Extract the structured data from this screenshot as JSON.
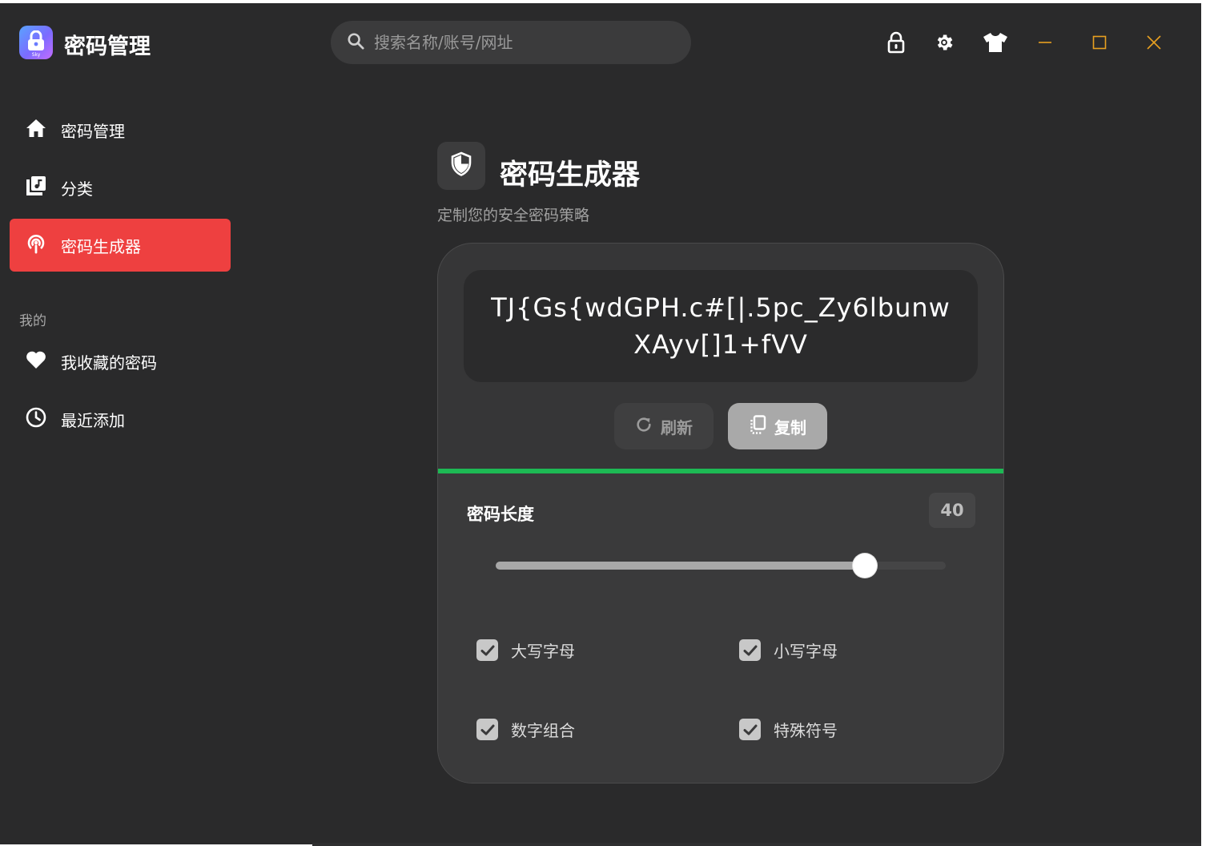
{
  "app": {
    "title": "密码管理",
    "logo_text": "Sky"
  },
  "search": {
    "placeholder": "搜索名称/账号/网址"
  },
  "toolbar": {
    "icons": [
      "lock-icon",
      "gear-icon",
      "tshirt-icon"
    ]
  },
  "window_controls": {
    "accent_color": "#e8a020"
  },
  "sidebar": {
    "items": [
      {
        "label": "密码管理",
        "icon": "home-icon"
      },
      {
        "label": "分类",
        "icon": "music-library-icon"
      },
      {
        "label": "密码生成器",
        "icon": "podcast-icon",
        "active": true
      }
    ],
    "section_title": "我的",
    "my_items": [
      {
        "label": "我收藏的密码",
        "icon": "heart-icon"
      },
      {
        "label": "最近添加",
        "icon": "clock-icon"
      }
    ],
    "active_color": "#ee4040"
  },
  "generator": {
    "title": "密码生成器",
    "subtitle": "定制您的安全密码策略",
    "password": "TJ{Gs{wdGPH.c#[|.5pc_Zy6lbunwXAyv[]1+fVV",
    "refresh_label": "刷新",
    "copy_label": "复制",
    "strength_color": "#1db954",
    "length_label": "密码长度",
    "length_value": "40",
    "slider_fraction": 0.82,
    "options": [
      {
        "label": "大写字母",
        "checked": true
      },
      {
        "label": "小写字母",
        "checked": true
      },
      {
        "label": "数字组合",
        "checked": true
      },
      {
        "label": "特殊符号",
        "checked": true
      }
    ]
  }
}
